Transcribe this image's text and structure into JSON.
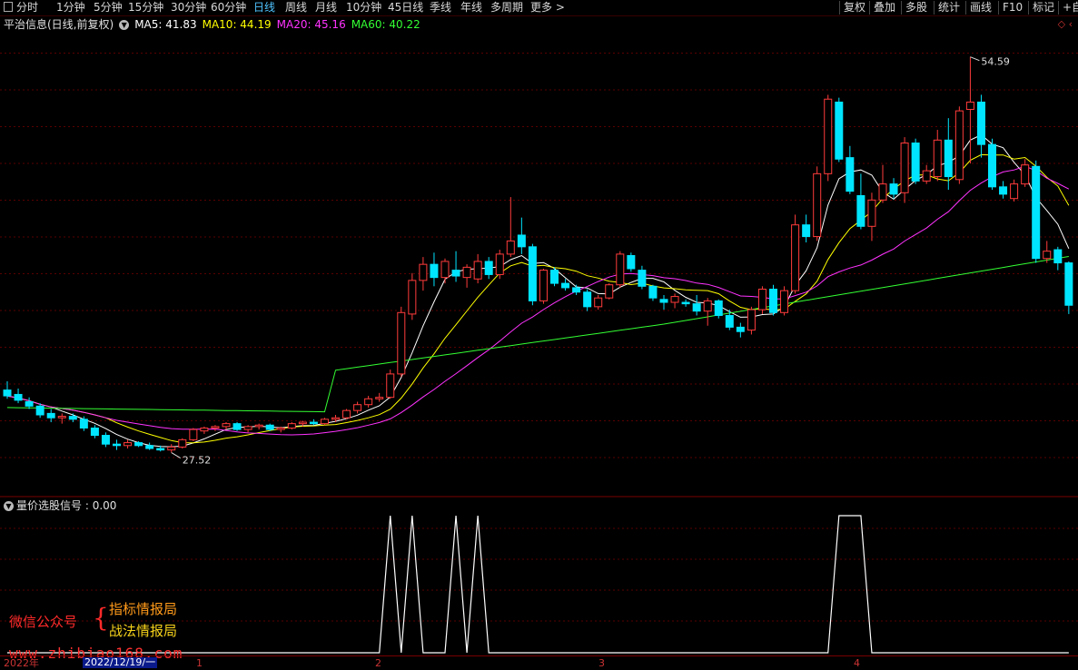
{
  "toolbar": {
    "left_items": [
      {
        "label": "分时",
        "active": false
      },
      {
        "label": "1分钟",
        "active": false
      },
      {
        "label": "5分钟",
        "active": false
      },
      {
        "label": "15分钟",
        "active": false
      },
      {
        "label": "30分钟",
        "active": false
      },
      {
        "label": "60分钟",
        "active": false
      },
      {
        "label": "日线",
        "active": true
      },
      {
        "label": "周线",
        "active": false
      },
      {
        "label": "月线",
        "active": false
      },
      {
        "label": "10分钟",
        "active": false
      },
      {
        "label": "45日线",
        "active": false
      },
      {
        "label": "季线",
        "active": false
      },
      {
        "label": "年线",
        "active": false
      },
      {
        "label": "多周期",
        "active": false
      },
      {
        "label": "更多 >",
        "active": false
      }
    ],
    "right_items": [
      {
        "label": "复权"
      },
      {
        "label": "叠加"
      },
      {
        "label": "多股"
      },
      {
        "label": "统计"
      },
      {
        "label": "画线"
      },
      {
        "label": "F10"
      },
      {
        "label": "标记"
      },
      {
        "label": "+自"
      }
    ]
  },
  "legend": {
    "title": "平治信息(日线,前复权)",
    "ma": [
      {
        "label": "MA5: 41.83",
        "color": "#ffffff"
      },
      {
        "label": "MA10: 44.19",
        "color": "#ffff00"
      },
      {
        "label": "MA20: 45.16",
        "color": "#ff33ff"
      },
      {
        "label": "MA60: 40.22",
        "color": "#33ff33"
      }
    ]
  },
  "price_annotations": {
    "high": "54.59",
    "low": "27.52"
  },
  "sub_legend": {
    "title": "量价选股信号",
    "value": ": 0.00"
  },
  "timeaxis": {
    "year_label": "2022年",
    "date_box": "2022/12/19/一",
    "month_ticks": [
      "1",
      "2",
      "3",
      "4"
    ]
  },
  "colors": {
    "up": "#ff3b3b",
    "down": "#00e5ff",
    "ma5": "#ffffff",
    "ma10": "#ffff00",
    "ma20": "#ff33ff",
    "ma60": "#33ff33",
    "grid": "#5a0000",
    "signal": "#ffffff"
  },
  "watermark": {
    "left": "微信公众号",
    "line1": "指标情报局",
    "line2": "战法情报局",
    "url": "www.zhibiao168.com"
  },
  "chart_data": {
    "type": "candlestick",
    "ohlc": [
      [
        31.8,
        32.4,
        31.2,
        31.4
      ],
      [
        31.5,
        31.9,
        30.9,
        31.1
      ],
      [
        31.0,
        31.3,
        30.5,
        30.7
      ],
      [
        30.7,
        30.9,
        29.9,
        30.1
      ],
      [
        30.2,
        30.5,
        29.6,
        29.9
      ],
      [
        29.9,
        30.2,
        29.5,
        30.0
      ],
      [
        30.0,
        30.2,
        29.6,
        29.8
      ],
      [
        29.8,
        30.0,
        29.0,
        29.2
      ],
      [
        29.2,
        29.4,
        28.5,
        28.7
      ],
      [
        28.7,
        28.9,
        27.9,
        28.1
      ],
      [
        28.1,
        28.4,
        27.7,
        28.0
      ],
      [
        28.0,
        28.4,
        27.8,
        28.2
      ],
      [
        28.2,
        28.3,
        27.9,
        28.0
      ],
      [
        28.0,
        28.2,
        27.7,
        27.8
      ],
      [
        27.8,
        28.0,
        27.6,
        27.7
      ],
      [
        27.7,
        28.1,
        27.52,
        27.9
      ],
      [
        27.9,
        28.5,
        27.8,
        28.4
      ],
      [
        28.4,
        29.2,
        28.3,
        29.1
      ],
      [
        29.0,
        29.3,
        28.8,
        29.2
      ],
      [
        29.2,
        29.4,
        29.0,
        29.3
      ],
      [
        29.3,
        29.6,
        29.1,
        29.5
      ],
      [
        29.5,
        29.6,
        29.0,
        29.1
      ],
      [
        29.1,
        29.4,
        28.9,
        29.3
      ],
      [
        29.3,
        29.5,
        29.1,
        29.4
      ],
      [
        29.4,
        29.5,
        29.0,
        29.1
      ],
      [
        29.1,
        29.3,
        28.9,
        29.2
      ],
      [
        29.2,
        29.6,
        29.1,
        29.5
      ],
      [
        29.5,
        29.7,
        29.3,
        29.6
      ],
      [
        29.6,
        29.8,
        29.4,
        29.5
      ],
      [
        29.5,
        29.9,
        29.4,
        29.8
      ],
      [
        29.8,
        30.1,
        29.6,
        29.9
      ],
      [
        29.9,
        30.5,
        29.8,
        30.4
      ],
      [
        30.4,
        31.0,
        30.2,
        30.8
      ],
      [
        30.8,
        31.4,
        30.6,
        31.2
      ],
      [
        31.2,
        31.6,
        31.0,
        31.3
      ],
      [
        31.3,
        33.2,
        31.2,
        32.9
      ],
      [
        32.9,
        37.5,
        32.7,
        37.1
      ],
      [
        37.0,
        39.8,
        36.6,
        39.3
      ],
      [
        39.3,
        40.9,
        38.6,
        40.4
      ],
      [
        40.4,
        41.2,
        38.9,
        39.5
      ],
      [
        39.5,
        40.8,
        39.1,
        40.6
      ],
      [
        40.0,
        41.3,
        39.2,
        39.6
      ],
      [
        39.5,
        40.4,
        38.8,
        40.2
      ],
      [
        39.4,
        41.1,
        39.1,
        40.6
      ],
      [
        40.6,
        40.9,
        39.4,
        39.7
      ],
      [
        39.7,
        41.4,
        39.4,
        41.1
      ],
      [
        41.1,
        45.0,
        40.9,
        42.0
      ],
      [
        42.4,
        43.6,
        41.1,
        41.6
      ],
      [
        41.6,
        41.8,
        37.6,
        37.9
      ],
      [
        37.9,
        40.1,
        37.7,
        40.0
      ],
      [
        40.0,
        40.2,
        38.9,
        39.1
      ],
      [
        39.1,
        39.4,
        38.6,
        38.8
      ],
      [
        38.8,
        39.0,
        38.3,
        38.5
      ],
      [
        38.5,
        38.7,
        37.2,
        37.5
      ],
      [
        37.5,
        38.3,
        37.3,
        38.1
      ],
      [
        38.1,
        39.1,
        38.0,
        39.0
      ],
      [
        39.0,
        41.3,
        38.8,
        41.1
      ],
      [
        41.0,
        41.2,
        39.9,
        40.1
      ],
      [
        40.0,
        40.3,
        38.7,
        38.9
      ],
      [
        38.9,
        39.0,
        37.9,
        38.1
      ],
      [
        38.0,
        38.3,
        37.3,
        37.8
      ],
      [
        37.8,
        38.4,
        37.4,
        38.2
      ],
      [
        37.8,
        38.0,
        37.5,
        37.7
      ],
      [
        37.7,
        38.3,
        36.9,
        37.2
      ],
      [
        37.2,
        38.1,
        36.2,
        37.9
      ],
      [
        37.9,
        38.0,
        36.7,
        36.9
      ],
      [
        36.9,
        37.3,
        35.9,
        36.1
      ],
      [
        36.1,
        36.4,
        35.4,
        35.8
      ],
      [
        35.9,
        37.5,
        35.6,
        37.3
      ],
      [
        37.3,
        38.9,
        37.0,
        38.7
      ],
      [
        38.7,
        39.0,
        36.9,
        37.1
      ],
      [
        37.1,
        38.9,
        36.9,
        38.6
      ],
      [
        38.6,
        43.8,
        38.4,
        43.1
      ],
      [
        43.1,
        43.8,
        41.9,
        42.3
      ],
      [
        42.3,
        47.1,
        42.0,
        46.6
      ],
      [
        46.6,
        52.0,
        46.1,
        51.7
      ],
      [
        51.5,
        51.8,
        47.4,
        47.6
      ],
      [
        47.7,
        48.5,
        45.2,
        45.4
      ],
      [
        45.1,
        46.6,
        42.8,
        43.0
      ],
      [
        43.0,
        45.3,
        42.0,
        44.8
      ],
      [
        44.8,
        47.2,
        44.6,
        45.9
      ],
      [
        45.9,
        46.3,
        44.9,
        45.2
      ],
      [
        45.3,
        49.1,
        44.6,
        48.7
      ],
      [
        48.7,
        49.0,
        45.9,
        46.1
      ],
      [
        46.1,
        47.2,
        45.9,
        46.8
      ],
      [
        46.4,
        49.6,
        46.1,
        48.9
      ],
      [
        48.9,
        50.4,
        45.5,
        46.4
      ],
      [
        46.2,
        51.2,
        45.9,
        50.9
      ],
      [
        51.0,
        54.59,
        47.3,
        51.5
      ],
      [
        51.5,
        52.0,
        47.7,
        48.6
      ],
      [
        48.6,
        49.0,
        45.5,
        45.7
      ],
      [
        45.7,
        46.1,
        44.9,
        45.2
      ],
      [
        44.9,
        46.2,
        44.7,
        45.9
      ],
      [
        45.9,
        47.6,
        45.7,
        47.2
      ],
      [
        47.1,
        47.5,
        40.5,
        40.8
      ],
      [
        40.8,
        42.0,
        40.5,
        41.3
      ],
      [
        41.4,
        41.6,
        40.0,
        40.5
      ],
      [
        40.5,
        40.6,
        37.0,
        37.6
      ]
    ],
    "signal": [
      0,
      0,
      0,
      0,
      0,
      0,
      0,
      0,
      0,
      0,
      0,
      0,
      0,
      0,
      0,
      0,
      0,
      0,
      0,
      0,
      0,
      0,
      0,
      0,
      0,
      0,
      0,
      0,
      0,
      0,
      0,
      0,
      0,
      0,
      0,
      1,
      0,
      1,
      0,
      0,
      0,
      1,
      0,
      1,
      0,
      0,
      0,
      0,
      0,
      0,
      0,
      0,
      0,
      0,
      0,
      0,
      0,
      0,
      0,
      0,
      0,
      0,
      0,
      0,
      0,
      0,
      0,
      0,
      0,
      0,
      0,
      0,
      0,
      0,
      0,
      0,
      1,
      1,
      1,
      0,
      0,
      0,
      0,
      0,
      0,
      0,
      0,
      0,
      0,
      0,
      0,
      0,
      0,
      0,
      0,
      0,
      0,
      0
    ],
    "ylim": [
      26,
      56
    ]
  }
}
